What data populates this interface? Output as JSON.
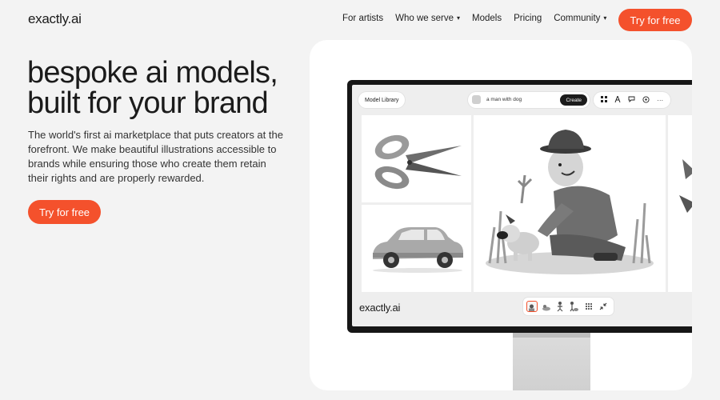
{
  "brand": {
    "logo": "exactly.ai"
  },
  "nav": {
    "links": [
      "For artists",
      "Who we serve",
      "Models",
      "Pricing",
      "Community"
    ],
    "caret": "▾",
    "cta": "Try for free"
  },
  "hero": {
    "title_line1": "bespoke ai models,",
    "title_line2": "built for your brand",
    "description": "The world's first ai marketplace that puts creators at the forefront. We make beautiful illustrations accessible to brands while ensuring those who create them retain their rights and are properly rewarded.",
    "cta": "Try for free"
  },
  "app": {
    "model_library": "Model Library",
    "prompt": "a man with dog",
    "create": "Create",
    "tools": [
      "grid-icon",
      "pen-icon",
      "speech-bubble-icon",
      "target-icon",
      "more-icon"
    ],
    "more_glyph": "···",
    "brand": "exactly.ai",
    "thumbnails": [
      "man-with-dog-thumb",
      "dog-thumb",
      "figure-thumb",
      "person-with-dog-thumb",
      "dots-grid-icon",
      "collapse-icon"
    ]
  },
  "colors": {
    "accent": "#f4512c",
    "background": "#f3f3f3",
    "card": "#ffffff",
    "monitor": "#161616"
  }
}
